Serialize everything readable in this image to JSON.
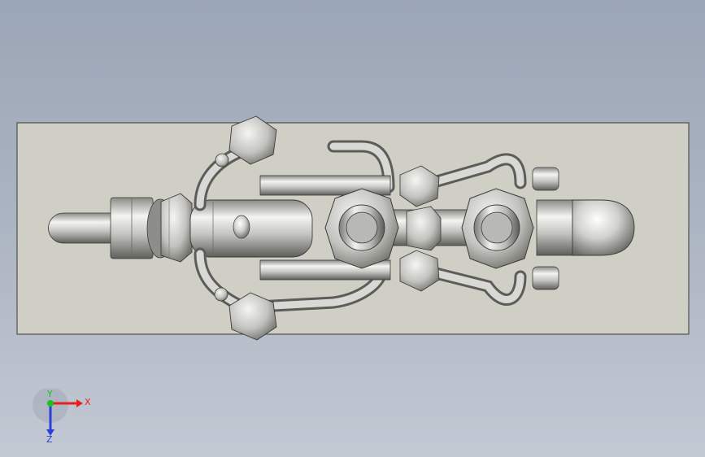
{
  "viewport": {
    "background_top": "#9ba6b6",
    "background_bottom": "#c3c9d3",
    "plate_color": "#cfcfc6",
    "metal_color": "#c8c8c4"
  },
  "triad": {
    "x_label": "X",
    "y_label": "Y",
    "z_label": "Z",
    "x_color": "#e8201c",
    "y_color": "#1cc21c",
    "z_color": "#2a3fd8"
  }
}
